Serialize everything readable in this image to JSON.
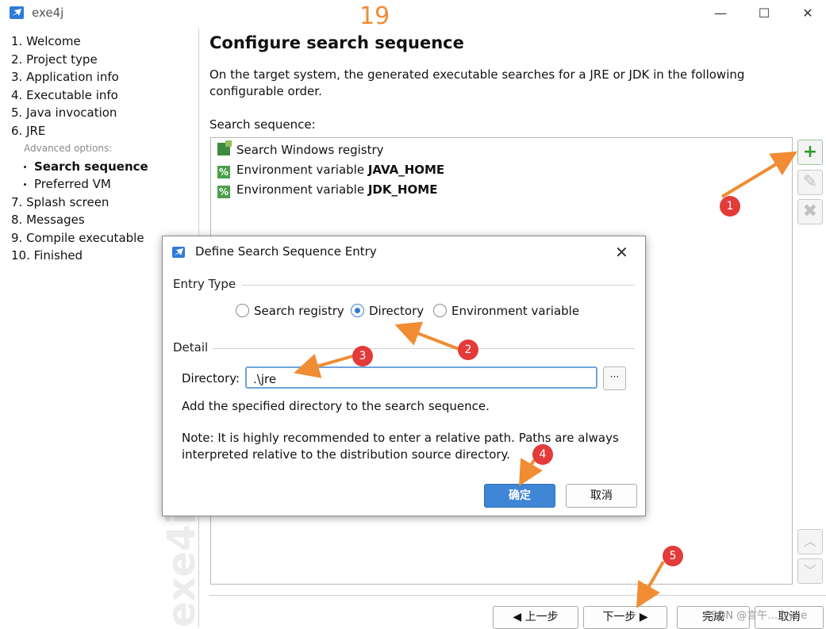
{
  "window": {
    "title": "exe4j",
    "minimize": "—",
    "maximize": "☐",
    "close": "✕"
  },
  "annotation_top": "19",
  "nav": {
    "items": [
      {
        "label": "1. Welcome"
      },
      {
        "label": "2. Project type"
      },
      {
        "label": "3. Application info"
      },
      {
        "label": "4. Executable info"
      },
      {
        "label": "5. Java invocation"
      },
      {
        "label": "6. JRE"
      }
    ],
    "advanced_label": "Advanced options:",
    "sub_items": [
      {
        "label": "Search sequence",
        "active": true
      },
      {
        "label": "Preferred VM",
        "active": false
      }
    ],
    "items_after": [
      {
        "label": "7. Splash screen"
      },
      {
        "label": "8. Messages"
      },
      {
        "label": "9. Compile executable"
      },
      {
        "label": "10. Finished"
      }
    ],
    "watermark": "exe4j"
  },
  "main": {
    "title": "Configure search sequence",
    "description": "On the target system, the generated executable searches for a JRE or JDK in the following configurable order.",
    "sequence_label": "Search sequence:",
    "entries": [
      {
        "prefix": "Search Windows registry",
        "bold": "",
        "icon": "registry-icon"
      },
      {
        "prefix": "Environment variable ",
        "bold": "JAVA_HOME",
        "icon": "env-variable-icon"
      },
      {
        "prefix": "Environment variable ",
        "bold": "JDK_HOME",
        "icon": "env-variable-icon"
      }
    ],
    "side_buttons": {
      "add": "+",
      "edit": "✎",
      "remove": "✖",
      "up": "︿",
      "down": "﹀"
    }
  },
  "footer": {
    "back": "◀  上一步",
    "next": "下一步  ▶",
    "finish": "完成",
    "cancel": "取消",
    "watermark": "CSDN @言午……yue"
  },
  "dialog": {
    "title": "Define Search Sequence Entry",
    "close": "✕",
    "entry_type_label": "Entry Type",
    "options": [
      {
        "label": "Search registry",
        "selected": false
      },
      {
        "label": "Directory",
        "selected": true
      },
      {
        "label": "Environment variable",
        "selected": false
      }
    ],
    "detail_label": "Detail",
    "directory_label": "Directory:",
    "directory_value": ".\\jre",
    "browse_label": "···",
    "help_text": "Add the specified directory to the search sequence.",
    "note_line1": "Note: It is highly recommended to enter a relative path. Paths are always",
    "note_line2": "interpreted relative to the distribution source directory.",
    "ok": "确定",
    "cancel": "取消"
  },
  "badges": [
    "1",
    "2",
    "3",
    "4",
    "5"
  ],
  "colors": {
    "accent": "#3f86d6",
    "annotation_orange": "#f08c33",
    "badge_red": "#e33a3a",
    "add_green": "#2f9a2f"
  }
}
